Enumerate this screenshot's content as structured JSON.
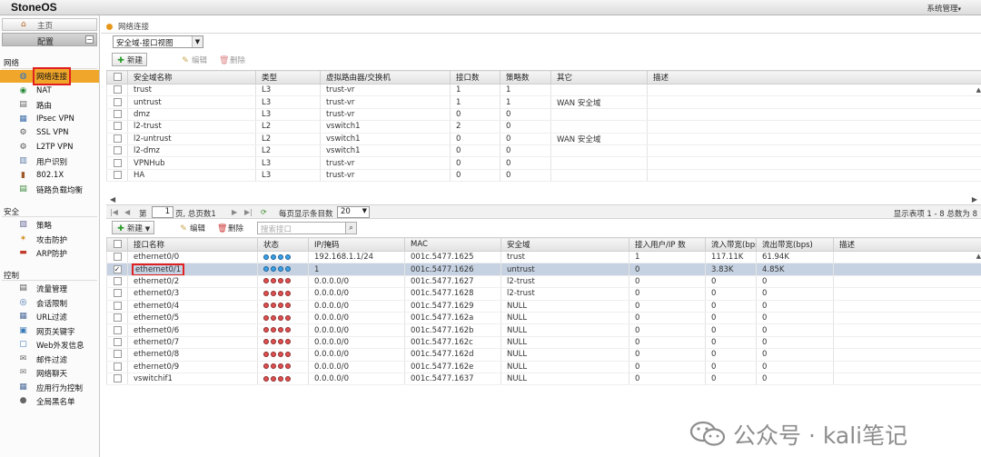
{
  "app": {
    "title": "StoneOS",
    "user_menu": "系统管理"
  },
  "sidebar": {
    "home": "主页",
    "config": "配置",
    "collapse_icon": "minus-icon",
    "sections": {
      "network": "网络",
      "security": "安全",
      "control": "控制"
    },
    "network_items": [
      {
        "label": "网络连接",
        "icon": "globe-network-icon"
      },
      {
        "label": "NAT",
        "icon": "nat-globe-icon"
      },
      {
        "label": "路由",
        "icon": "router-icon"
      },
      {
        "label": "IPsec VPN",
        "icon": "ipsec-vpn-icon"
      },
      {
        "label": "SSL VPN",
        "icon": "ssl-vpn-icon"
      },
      {
        "label": "L2TP VPN",
        "icon": "l2tp-vpn-icon"
      },
      {
        "label": "用户识别",
        "icon": "user-identify-icon"
      },
      {
        "label": "802.1X",
        "icon": "dot1x-icon"
      },
      {
        "label": "链路负载均衡",
        "icon": "link-balance-icon"
      }
    ],
    "security_items": [
      {
        "label": "策略",
        "icon": "policy-icon"
      },
      {
        "label": "攻击防护",
        "icon": "attack-defense-icon"
      },
      {
        "label": "ARP防护",
        "icon": "arp-defense-icon"
      }
    ],
    "control_items": [
      {
        "label": "流量管理",
        "icon": "traffic-icon"
      },
      {
        "label": "会话限制",
        "icon": "session-limit-icon"
      },
      {
        "label": "URL过滤",
        "icon": "url-filter-icon"
      },
      {
        "label": "网页关键字",
        "icon": "web-keyword-icon"
      },
      {
        "label": "Web外发信息",
        "icon": "web-post-icon"
      },
      {
        "label": "邮件过滤",
        "icon": "mail-filter-icon"
      },
      {
        "label": "网络聊天",
        "icon": "im-chat-icon"
      },
      {
        "label": "应用行为控制",
        "icon": "app-control-icon"
      },
      {
        "label": "全局黑名单",
        "icon": "blacklist-icon"
      }
    ]
  },
  "main": {
    "page_title": "网络连接",
    "view_select": "安全域-接口视图",
    "zone_toolbar": {
      "new": "新建",
      "edit": "编辑",
      "delete": "删除"
    },
    "zone_table": {
      "columns": [
        "安全域名称",
        "类型",
        "虚拟路由器/交换机",
        "接口数",
        "策略数",
        "其它",
        "描述"
      ],
      "rows": [
        [
          "trust",
          "L3",
          "trust-vr",
          "1",
          "1",
          "",
          ""
        ],
        [
          "untrust",
          "L3",
          "trust-vr",
          "1",
          "1",
          "WAN 安全域",
          ""
        ],
        [
          "dmz",
          "L3",
          "trust-vr",
          "0",
          "0",
          "",
          ""
        ],
        [
          "l2-trust",
          "L2",
          "vswitch1",
          "2",
          "0",
          "",
          ""
        ],
        [
          "l2-untrust",
          "L2",
          "vswitch1",
          "0",
          "0",
          "WAN 安全域",
          ""
        ],
        [
          "l2-dmz",
          "L2",
          "vswitch1",
          "0",
          "0",
          "",
          ""
        ],
        [
          "VPNHub",
          "L3",
          "trust-vr",
          "0",
          "0",
          "",
          ""
        ],
        [
          "HA",
          "L3",
          "trust-vr",
          "0",
          "0",
          "",
          ""
        ]
      ]
    },
    "pager": {
      "page_prefix": "第",
      "page_value": "1",
      "page_suffix": "页, 总页数1",
      "per_page_label": "每页显示条目数",
      "per_page_value": "20",
      "summary": "显示表项 1 - 8 总数为 8"
    },
    "iface_toolbar": {
      "new": "新建",
      "edit": "编辑",
      "delete": "删除",
      "search_placeholder": "搜索接口"
    },
    "iface_table": {
      "columns": [
        "接口名称",
        "状态",
        "IP/掩码",
        "MAC",
        "安全域",
        "接入用户/IP 数",
        "流入带宽(bps)",
        "流出带宽(bps)",
        "描述"
      ],
      "rows": [
        {
          "name": "ethernet0/0",
          "status": "up",
          "ip": "192.168.1.1/24",
          "mac": "001c.5477.1625",
          "zone": "trust",
          "users": "1",
          "in": "117.11K",
          "out": "61.94K",
          "checked": false
        },
        {
          "name": "ethernet0/1",
          "status": "up",
          "ip": "1",
          "mac": "001c.5477.1626",
          "zone": "untrust",
          "users": "0",
          "in": "3.83K",
          "out": "4.85K",
          "checked": true
        },
        {
          "name": "ethernet0/2",
          "status": "down",
          "ip": "0.0.0.0/0",
          "mac": "001c.5477.1627",
          "zone": "l2-trust",
          "users": "0",
          "in": "0",
          "out": "0",
          "checked": false
        },
        {
          "name": "ethernet0/3",
          "status": "down",
          "ip": "0.0.0.0/0",
          "mac": "001c.5477.1628",
          "zone": "l2-trust",
          "users": "0",
          "in": "0",
          "out": "0",
          "checked": false
        },
        {
          "name": "ethernet0/4",
          "status": "down",
          "ip": "0.0.0.0/0",
          "mac": "001c.5477.1629",
          "zone": "NULL",
          "users": "0",
          "in": "0",
          "out": "0",
          "checked": false
        },
        {
          "name": "ethernet0/5",
          "status": "down",
          "ip": "0.0.0.0/0",
          "mac": "001c.5477.162a",
          "zone": "NULL",
          "users": "0",
          "in": "0",
          "out": "0",
          "checked": false
        },
        {
          "name": "ethernet0/6",
          "status": "down",
          "ip": "0.0.0.0/0",
          "mac": "001c.5477.162b",
          "zone": "NULL",
          "users": "0",
          "in": "0",
          "out": "0",
          "checked": false
        },
        {
          "name": "ethernet0/7",
          "status": "down",
          "ip": "0.0.0.0/0",
          "mac": "001c.5477.162c",
          "zone": "NULL",
          "users": "0",
          "in": "0",
          "out": "0",
          "checked": false
        },
        {
          "name": "ethernet0/8",
          "status": "down",
          "ip": "0.0.0.0/0",
          "mac": "001c.5477.162d",
          "zone": "NULL",
          "users": "0",
          "in": "0",
          "out": "0",
          "checked": false
        },
        {
          "name": "ethernet0/9",
          "status": "down",
          "ip": "0.0.0.0/0",
          "mac": "001c.5477.162e",
          "zone": "NULL",
          "users": "0",
          "in": "0",
          "out": "0",
          "checked": false
        },
        {
          "name": "vswitchif1",
          "status": "down",
          "ip": "0.0.0.0/0",
          "mac": "001c.5477.1637",
          "zone": "NULL",
          "users": "0",
          "in": "0",
          "out": "0",
          "checked": false
        }
      ]
    }
  },
  "watermark": "公众号 · kali笔记",
  "colors": {
    "active_nav": "#f0a62a",
    "highlight_border": "#e02020",
    "selected_row": "#c6d2e2",
    "status_up": "#3aa0e8",
    "status_down": "#e05050"
  }
}
